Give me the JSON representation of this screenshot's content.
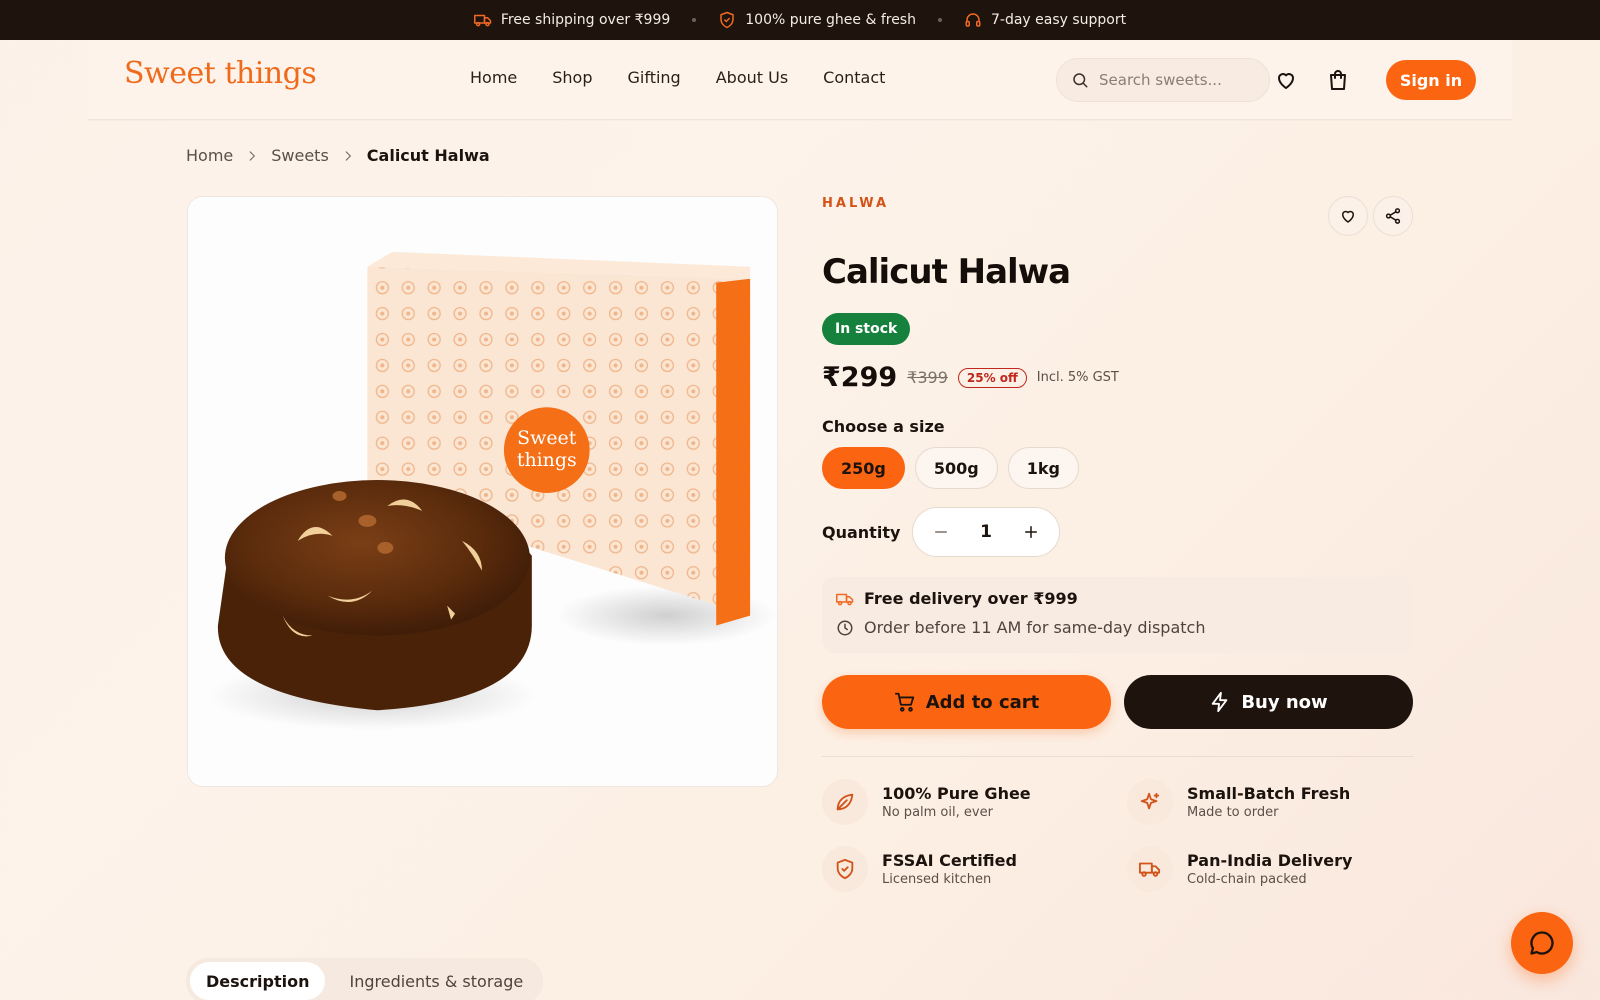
{
  "announcement": [
    {
      "text": "Free shipping over ₹999",
      "icon": "truck-icon"
    },
    {
      "text": "100% pure ghee & fresh",
      "icon": "shield-icon"
    },
    {
      "text": "7-day easy support",
      "icon": "headset-icon"
    }
  ],
  "header": {
    "logo": "Sweet things",
    "nav": [
      "Home",
      "Shop",
      "Gifting",
      "About Us",
      "Contact"
    ],
    "search_placeholder": "Search sweets...",
    "signin_label": "Sign in"
  },
  "breadcrumb": [
    "Home",
    "Sweets",
    "Calicut Halwa"
  ],
  "product": {
    "category": "HALWA",
    "name": "Calicut Halwa",
    "stock_status": "In stock",
    "price": "₹299",
    "old_price": "₹399",
    "discount": "25% off",
    "tax_note": "Incl. 5% GST",
    "size_label": "Choose a size",
    "sizes": [
      "250g",
      "500g",
      "1kg"
    ],
    "selected_size": "250g",
    "quantity_label": "Quantity",
    "quantity": "1",
    "image_box_text_1": "Sweet",
    "image_box_text_2": "things"
  },
  "delivery": {
    "line1": "Free delivery over ₹999",
    "line2": "Order before 11 AM for same-day dispatch"
  },
  "actions": {
    "add_to_cart": "Add to cart",
    "buy_now": "Buy now"
  },
  "features": [
    {
      "title": "100% Pure Ghee",
      "subtitle": "No palm oil, ever",
      "icon": "leaf-icon"
    },
    {
      "title": "Small-Batch Fresh",
      "subtitle": "Made to order",
      "icon": "sparkle-icon"
    },
    {
      "title": "FSSAI Certified",
      "subtitle": "Licensed kitchen",
      "icon": "shield-check-icon"
    },
    {
      "title": "Pan-India Delivery",
      "subtitle": "Cold-chain packed",
      "icon": "truck-icon"
    }
  ],
  "tabs": [
    "Description",
    "Ingredients & storage"
  ],
  "colors": {
    "accent": "#fb6410",
    "dark": "#1e130d",
    "stock_green": "#16813d",
    "discount_red": "#c0271d"
  }
}
